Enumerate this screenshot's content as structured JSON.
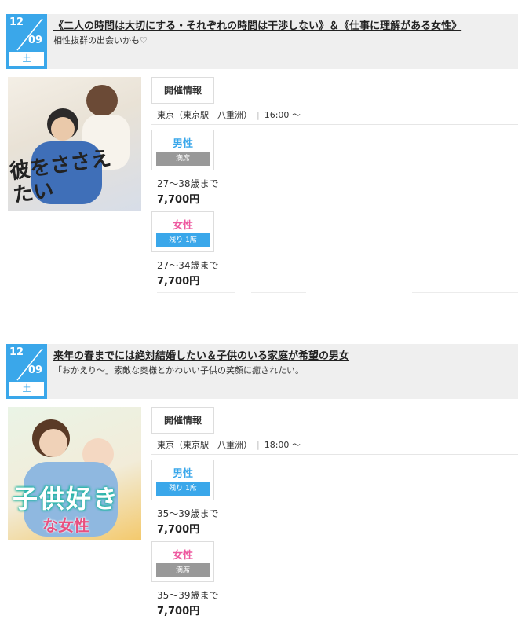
{
  "events": [
    {
      "date": {
        "month": "12",
        "day": "09",
        "weekday": "土"
      },
      "title": "《二人の時間は大切にする・それぞれの時間は干渉しない》＆《仕事に理解がある女性》",
      "subtitle": "相性抜群の出会いかも♡",
      "thumb_text": "彼をささえたい",
      "info_label": "開催情報",
      "place": "東京（東京駅　八重洲）",
      "time": "16:00 ～",
      "male": {
        "label": "男性",
        "status": "満席",
        "age": "27～38歳まで",
        "price": "7,700円"
      },
      "female": {
        "label": "女性",
        "status": "残り 1席",
        "age": "27～34歳まで",
        "price": "7,700円"
      }
    },
    {
      "date": {
        "month": "12",
        "day": "09",
        "weekday": "土"
      },
      "title": "来年の春までには絶対結婚したい＆子供のいる家庭が希望の男女",
      "subtitle": "「おかえり～」素敵な奥様とかわいい子供の笑顔に癒されたい。",
      "thumb_text_1": "子供好き",
      "thumb_text_2": "な女性",
      "info_label": "開催情報",
      "place": "東京（東京駅　八重洲）",
      "time": "18:00 ～",
      "male": {
        "label": "男性",
        "status": "残り 1席",
        "age": "35～39歳まで",
        "price": "7,700円"
      },
      "female": {
        "label": "女性",
        "status": "満席",
        "age": "35～39歳まで",
        "price": "7,700円"
      }
    }
  ],
  "colors": {
    "accent": "#3aa7ea",
    "female": "#ee5aa0",
    "full": "#999999"
  }
}
